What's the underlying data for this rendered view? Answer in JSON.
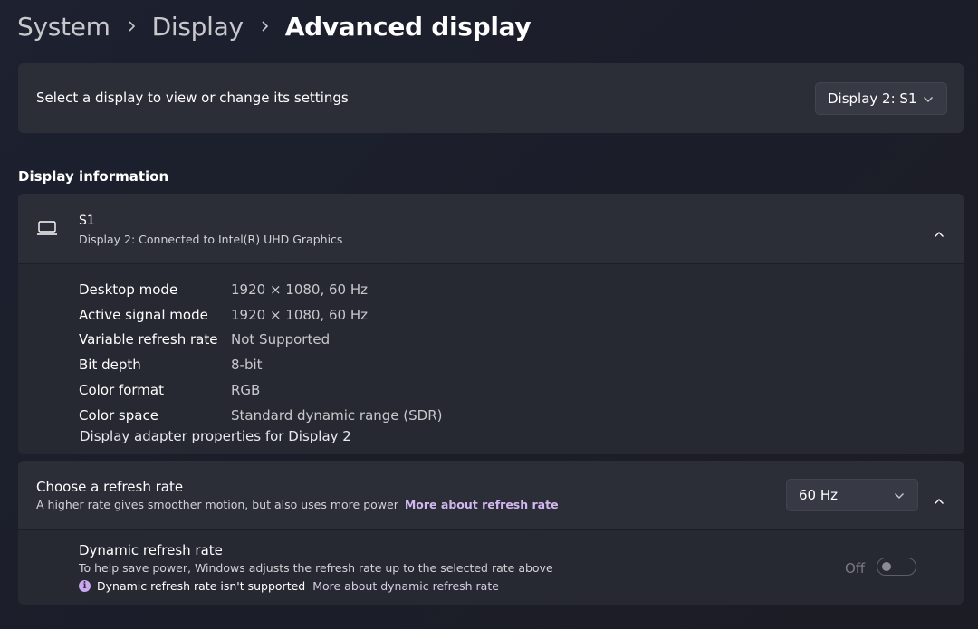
{
  "breadcrumb": {
    "items": [
      "System",
      "Display"
    ],
    "current": "Advanced display"
  },
  "display_select": {
    "label": "Select a display to view or change its settings",
    "selected": "Display 2: S1"
  },
  "display_info": {
    "section_title": "Display information",
    "name": "S1",
    "subtitle": "Display 2: Connected to Intel(R) UHD Graphics",
    "rows": [
      {
        "key": "Desktop mode",
        "value": "1920 × 1080, 60 Hz"
      },
      {
        "key": "Active signal mode",
        "value": "1920 × 1080, 60 Hz"
      },
      {
        "key": "Variable refresh rate",
        "value": "Not Supported"
      },
      {
        "key": "Bit depth",
        "value": "8-bit"
      },
      {
        "key": "Color format",
        "value": "RGB"
      },
      {
        "key": "Color space",
        "value": "Standard dynamic range (SDR)"
      }
    ],
    "adapter_link": "Display adapter properties for Display 2"
  },
  "refresh_rate": {
    "title": "Choose a refresh rate",
    "subtitle": "A higher rate gives smoother motion, but also uses more power",
    "link": "More about refresh rate",
    "selected": "60 Hz"
  },
  "dynamic_refresh": {
    "title": "Dynamic refresh rate",
    "subtitle": "To help save power, Windows adjusts the refresh rate up to the selected rate above",
    "note": "Dynamic refresh rate isn't supported",
    "note_icon_glyph": "i",
    "link": "More about dynamic refresh rate",
    "toggle_label": "Off",
    "toggle_state": false
  },
  "colors": {
    "accent_link": "#d3b8f0",
    "card_bg": "#2b2d37"
  }
}
